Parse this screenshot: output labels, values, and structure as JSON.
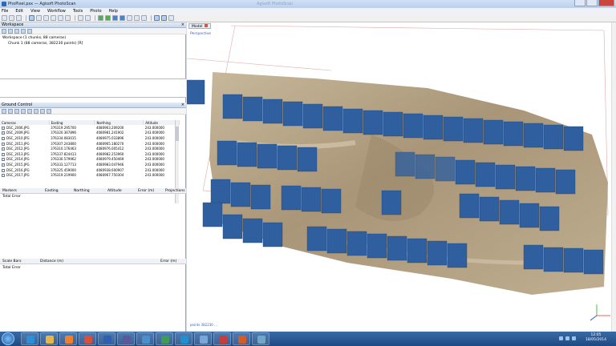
{
  "window": {
    "title": "PhoPixel.psx — Agisoft PhotoScan",
    "ghost_title": "Agisoft PhotoScan"
  },
  "menu": [
    "File",
    "Edit",
    "View",
    "Workflow",
    "Tools",
    "Photo",
    "Help"
  ],
  "workspace": {
    "header": "Workspace",
    "line1": "Workspace (1 chunks, 88 cameras)",
    "line2": "Chunk 1 (88 cameras, 382230 points) [R]"
  },
  "ground_control": {
    "header": "Ground Control",
    "columns": [
      "Cameras",
      "Easting",
      "Northing",
      "Altitude"
    ],
    "rows": [
      {
        "name": "DSC_2006.JPG",
        "e": "376319.295700",
        "n": "4080963.209200",
        "a": "243.000000"
      },
      {
        "name": "DSC_2009.JPG",
        "e": "376320.367896",
        "n": "4080981.241902",
        "a": "243.000000"
      },
      {
        "name": "DSC_2010.JPG",
        "e": "376334.083015",
        "n": "4080975.033896",
        "a": "243.000000"
      },
      {
        "name": "DSC_2011.JPG",
        "e": "376307.243800",
        "n": "4080965.180270",
        "a": "243.000000"
      },
      {
        "name": "DSC_2012.JPG",
        "e": "376310.176463",
        "n": "4080976.005412",
        "a": "243.000000"
      },
      {
        "name": "DSC_2013.JPG",
        "e": "376337.824413",
        "n": "4080982.253960",
        "a": "243.000000"
      },
      {
        "name": "DSC_2014.JPG",
        "e": "376330.579962",
        "n": "4080979.450469",
        "a": "243.000000"
      },
      {
        "name": "DSC_2015.JPG",
        "e": "376333.127713",
        "n": "4080983.047946",
        "a": "243.000000"
      },
      {
        "name": "DSC_2016.JPG",
        "e": "376325.459000",
        "n": "4080938.600907",
        "a": "243.000000"
      },
      {
        "name": "DSC_2017.JPG",
        "e": "376319.219900",
        "n": "4080967.750304",
        "a": "243.000000"
      }
    ]
  },
  "markers": {
    "columns": [
      "Markers",
      "Easting",
      "Northing",
      "Altitude",
      "Error (m)",
      "Projections"
    ],
    "total_label": "Total Error"
  },
  "scalebars": {
    "columns": [
      "Scale Bars",
      "Distance (m)",
      "Error (m)"
    ],
    "total_label": "Total Error"
  },
  "viewport": {
    "tab_label": "Model",
    "perspective_label": "Perspective",
    "points_label": "points 382230 ..."
  },
  "taskbar": {
    "time": "12:05",
    "date": "18/05/2014"
  },
  "icons": {
    "start": "windows-start-icon",
    "taskbar_apps": [
      "ie-icon",
      "folder-icon",
      "media-icon",
      "chrome-icon",
      "word-icon",
      "film-icon",
      "photoscan-icon",
      "maps-icon",
      "globe-icon",
      "mail-icon",
      "pdf-icon",
      "ppt-icon",
      "image-icon"
    ]
  },
  "colors": {
    "camera_blue": "#2f5f9e",
    "ortho_tan": "#b8a78a",
    "accent": "#3a6aa5"
  }
}
